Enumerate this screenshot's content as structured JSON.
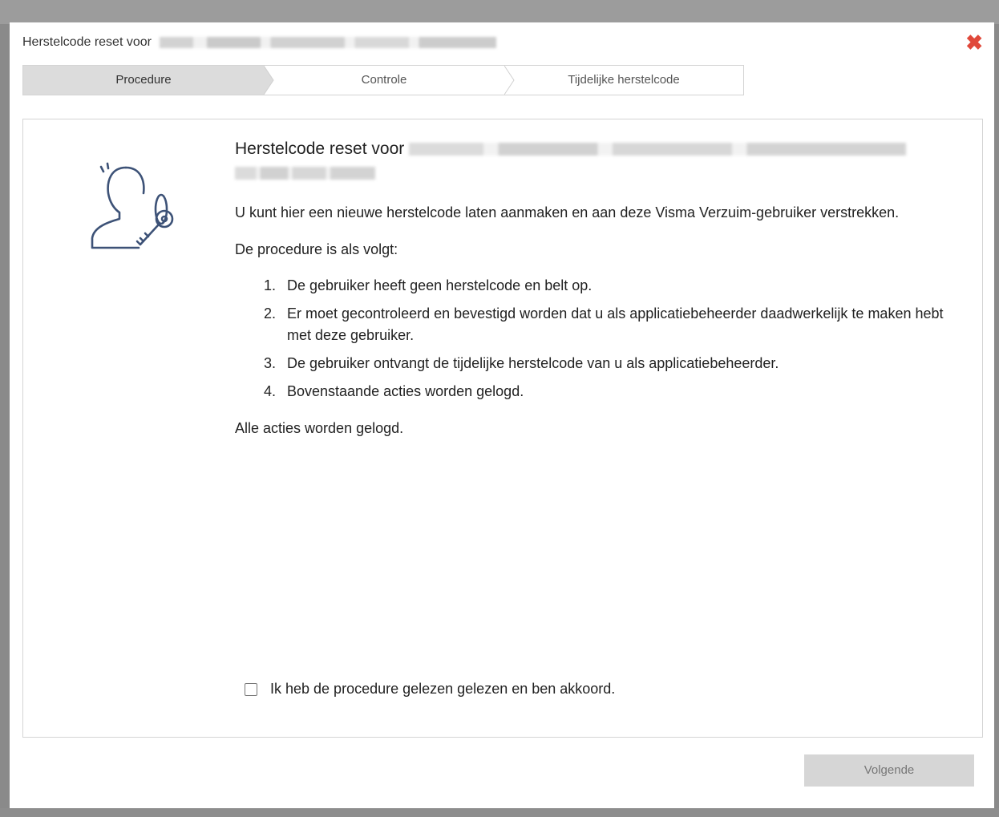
{
  "dialog": {
    "title": "Herstelcode reset voor",
    "close_icon": "close-x-icon",
    "close_color": "#e0483a"
  },
  "steps": [
    {
      "label": "Procedure"
    },
    {
      "label": "Controle"
    },
    {
      "label": "Tijdelijke herstelcode"
    }
  ],
  "content": {
    "icon": "user-key-icon",
    "heading": "Herstelcode reset voor",
    "intro": "U kunt hier een nieuwe herstelcode laten aanmaken en aan deze Visma Verzuim-gebruiker verstrekken.",
    "procedure_intro": "De procedure is als volgt:",
    "items": [
      {
        "num": "1.",
        "text": "De gebruiker heeft geen herstelcode en belt op."
      },
      {
        "num": "2.",
        "text": "Er moet gecontroleerd en bevestigd worden dat u als applicatiebeheerder daadwerkelijk te maken hebt met deze gebruiker."
      },
      {
        "num": "3.",
        "text": "De gebruiker ontvangt de tijdelijke herstelcode van u als applicatiebeheerder."
      },
      {
        "num": "4.",
        "text": "Bovenstaande acties worden gelogd."
      }
    ],
    "closing": "Alle acties worden gelogd.",
    "accept_label": "Ik heb de procedure gelezen gelezen en ben akkoord."
  },
  "footer": {
    "next_label": "Volgende"
  }
}
